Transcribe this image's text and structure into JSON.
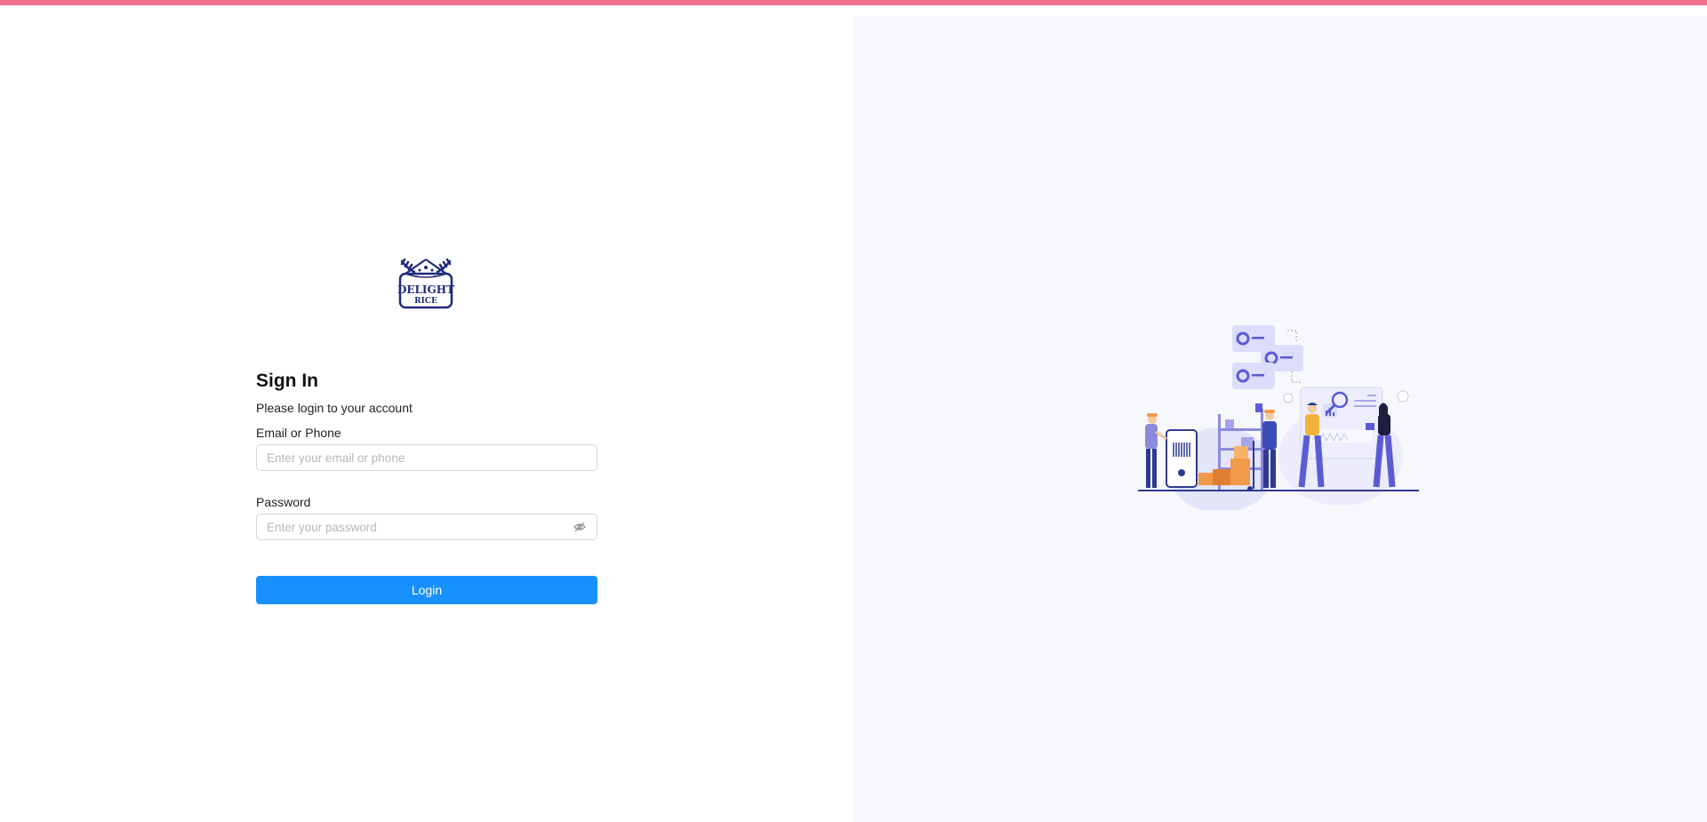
{
  "logo": {
    "line1": "DELIGHT",
    "line2": "RICE"
  },
  "signin": {
    "title": "Sign In",
    "subtitle": "Please login to your account",
    "email_label": "Email or Phone",
    "email_placeholder": "Enter your email or phone",
    "email_value": "",
    "password_label": "Password",
    "password_placeholder": "Enter your password",
    "password_value": "",
    "login_label": "Login"
  },
  "icons": {
    "password_toggle": "eye-invisible-icon",
    "illustration": "warehouse-inventory-illustration"
  },
  "colors": {
    "top_bar": "#f0708b",
    "primary": "#1890ff",
    "right_panel_bg": "#f7f8fc",
    "logo": "#1f2a7a",
    "illustration_accent": "#5b5bd6",
    "illustration_orange": "#f2994a"
  }
}
